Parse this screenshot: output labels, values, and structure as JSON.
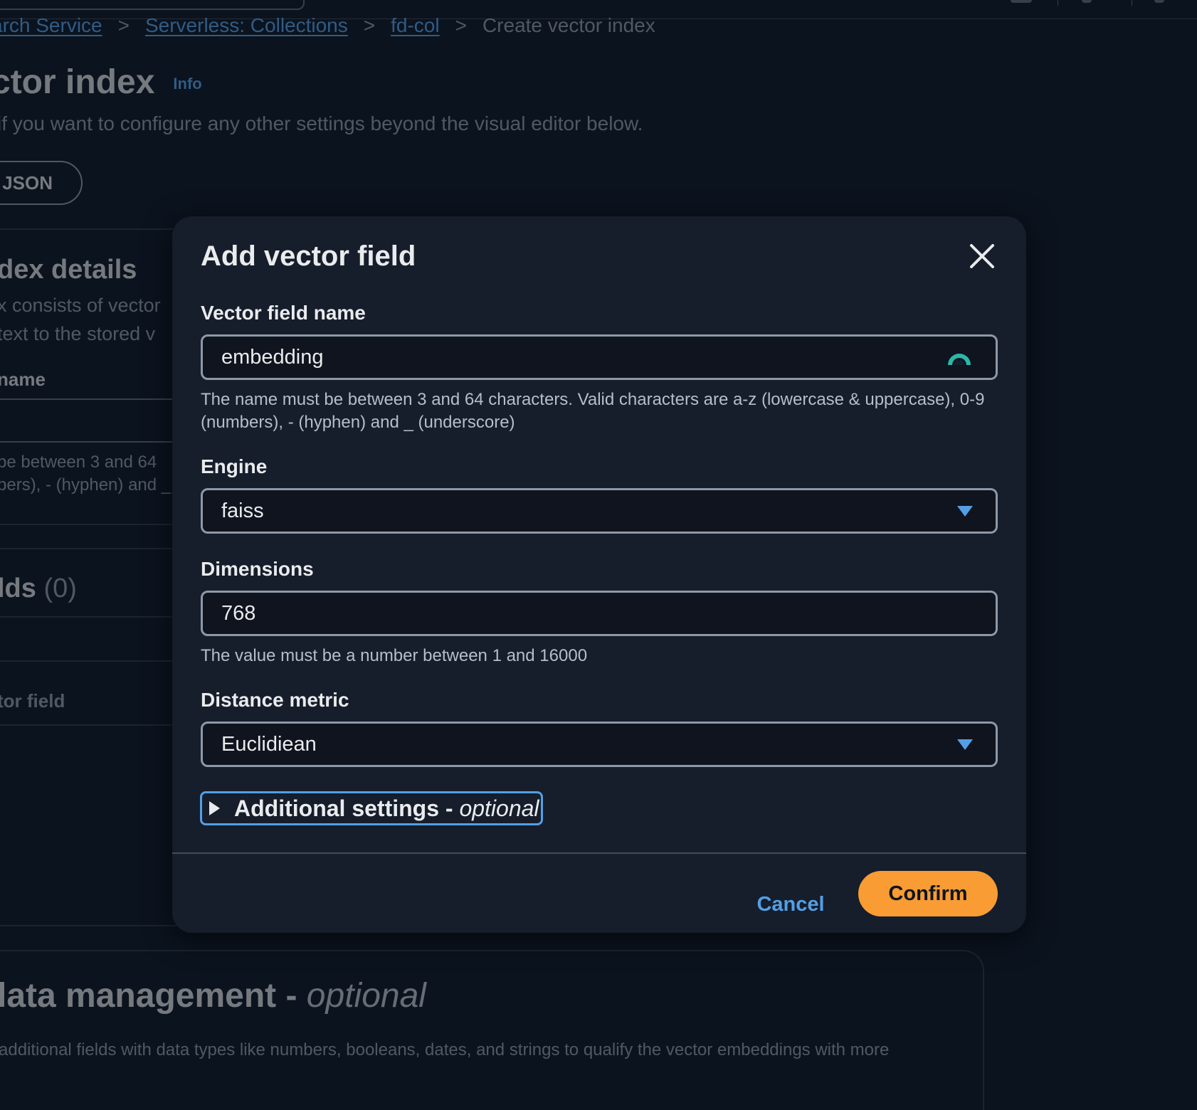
{
  "background": {
    "breadcrumb": [
      {
        "label": "arch Service"
      },
      {
        "label": "Serverless: Collections"
      },
      {
        "label": "fd-col"
      }
    ],
    "breadcrumb_current": "Create vector index",
    "page_title": "ctor index",
    "info_link": "Info",
    "page_description": "if you want to configure any other settings beyond the visual editor below.",
    "json_button": "JSON",
    "index_details_heading": "dex details",
    "index_details_desc_1": "x consists of vector",
    "index_details_desc_2": "text to the stored v",
    "name_label": "name",
    "name_hint_1": "be between 3 and 64",
    "name_hint_2": "bers), - (hyphen) and _",
    "fields_heading": "lds",
    "fields_count": "(0)",
    "add_vector_field": "tor field",
    "data_management_heading": "lata management - ",
    "data_management_optional": "optional",
    "data_management_desc": "additional fields with data types like numbers, booleans, dates, and strings to qualify the vector embeddings with more"
  },
  "modal": {
    "title": "Add vector field",
    "vector_field_name": {
      "label": "Vector field name",
      "value": "embedding",
      "hint": "The name must be between 3 and 64 characters. Valid characters are a-z (lowercase & uppercase), 0-9 (numbers), - (hyphen) and _ (underscore)"
    },
    "engine": {
      "label": "Engine",
      "value": "faiss"
    },
    "dimensions": {
      "label": "Dimensions",
      "value": "768",
      "hint": "The value must be a number between 1 and 16000"
    },
    "distance_metric": {
      "label": "Distance metric",
      "value": "Euclidiean"
    },
    "additional_settings": {
      "label": "Additional settings - ",
      "optional": "optional"
    },
    "cancel": "Cancel",
    "confirm": "Confirm"
  },
  "colors": {
    "accent": "#539fe5",
    "confirm": "#f89c33",
    "modal_bg": "#161d2b",
    "page_bg": "#0f1b2a"
  },
  "icons": [
    "close-icon",
    "password-manager-icon",
    "caret-down-icon",
    "caret-right-icon"
  ]
}
